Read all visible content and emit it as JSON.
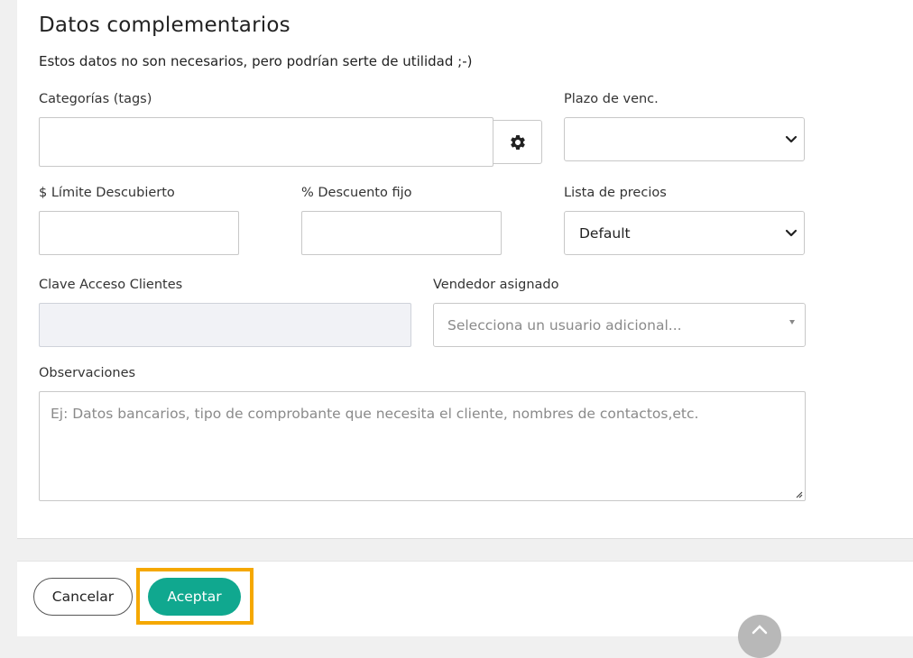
{
  "section": {
    "title": "Datos complementarios",
    "subtitle": "Estos datos no son necesarios, pero podrían serte de utilidad ;-)"
  },
  "fields": {
    "categorias": {
      "label": "Categorías (tags)",
      "value": ""
    },
    "plazo": {
      "label": "Plazo de venc.",
      "selected": ""
    },
    "limite": {
      "label": "$ Límite Descubierto",
      "value": ""
    },
    "descuento": {
      "label": "% Descuento fijo",
      "value": ""
    },
    "lista_precios": {
      "label": "Lista de precios",
      "selected": "Default"
    },
    "clave": {
      "label": "Clave Acceso Clientes",
      "value": ""
    },
    "vendedor": {
      "label": "Vendedor asignado",
      "placeholder": "Selecciona un usuario adicional..."
    },
    "observaciones": {
      "label": "Observaciones",
      "placeholder": "Ej: Datos bancarios, tipo de comprobante que necesita el cliente, nombres de contactos,etc."
    }
  },
  "actions": {
    "cancel_label": "Cancelar",
    "accept_label": "Aceptar"
  },
  "icons": {
    "gear": "gear-icon",
    "chevron": "chevron-down-icon",
    "scroll_top": "arrow-up-icon"
  },
  "colors": {
    "accent": "#10a88f",
    "highlight": "#f5a800"
  }
}
